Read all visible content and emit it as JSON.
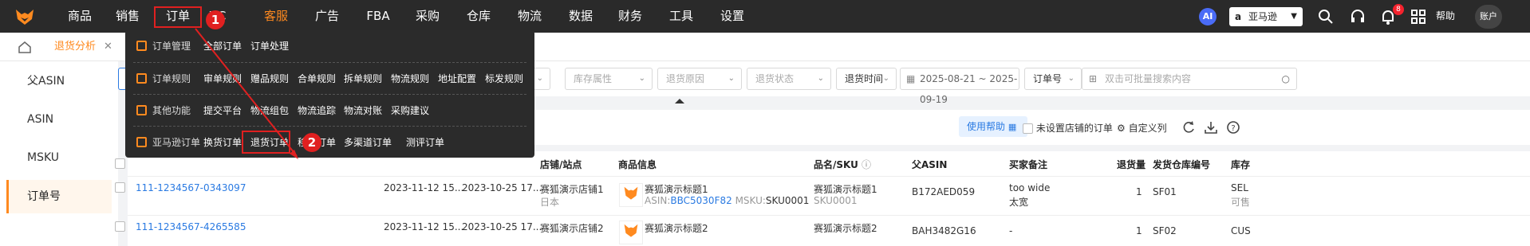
{
  "nav": {
    "items": [
      "商品",
      "销售",
      "订单",
      "VC",
      "客服",
      "广告",
      "FBA",
      "采购",
      "仓库",
      "物流",
      "数据",
      "财务",
      "工具",
      "设置"
    ],
    "ai_label": "AI",
    "marketplace": "亚马逊",
    "notification_count": "8",
    "help": "帮助",
    "account": "账户"
  },
  "tabs": {
    "active": "退货分析"
  },
  "sidebar": {
    "items": [
      "父ASIN",
      "ASIN",
      "MSKU",
      "订单号"
    ],
    "active_index": 3
  },
  "filters": {
    "inventory_attr": "库存属性",
    "return_reason": "退货原因",
    "return_status": "退货状态",
    "time_type": "退货时间",
    "date_range": "2025-08-21 ~ 2025-09-19",
    "search_field": "订单号",
    "search_placeholder": "双击可批量搜索内容"
  },
  "toolbar": {
    "help_btn": "使用帮助",
    "unset_store": "未设置店铺的订单",
    "custom_cols": "自定义列"
  },
  "table": {
    "headers": [
      "店铺/站点",
      "商品信息",
      "品名/SKU",
      "父ASIN",
      "买家备注",
      "退货量",
      "发货仓库编号",
      "库存"
    ],
    "rows": [
      {
        "order": "111-1234567-0343097",
        "date1": "2023-11-12 15...",
        "date2": "2023-10-25 17...",
        "store": "赛狐演示店铺1",
        "site": "日本",
        "product_title": "赛狐演示标题1",
        "asin_label": "ASIN:",
        "asin": "BBC5030F82",
        "msku_label": "MSKU:",
        "msku": "SKU0001",
        "name": "赛狐演示标题1",
        "sku": "SKU0001",
        "parent_asin": "B172AED059",
        "note1": "too wide",
        "note2": "太宽",
        "qty": "1",
        "warehouse": "SF01",
        "stock1": "SEL",
        "stock2": "可售"
      },
      {
        "order": "111-1234567-4265585",
        "date1": "2023-11-12 15...",
        "date2": "2023-10-25 17...",
        "store": "赛狐演示店铺2",
        "product_title": "赛狐演示标题2",
        "name": "赛狐演示标题2",
        "parent_asin": "BAH3482G16",
        "note1": "-",
        "qty": "1",
        "warehouse": "SF02",
        "stock1": "CUS"
      }
    ]
  },
  "menu": {
    "rows": [
      {
        "category": "订单管理",
        "links": [
          "全部订单",
          "订单处理"
        ]
      },
      {
        "category": "订单规则",
        "links": [
          "审单规则",
          "赠品规则",
          "合单规则",
          "拆单规则",
          "物流规则",
          "地址配置",
          "标发规则"
        ]
      },
      {
        "category": "其他功能",
        "links": [
          "提交平台",
          "物流组包",
          "物流追踪",
          "物流对账",
          "采购建议"
        ]
      },
      {
        "category": "亚马逊订单",
        "links": [
          "换货订单",
          "退货订单",
          "移除订单",
          "多渠道订单",
          "测评订单"
        ]
      }
    ]
  },
  "callouts": [
    "1",
    "2"
  ],
  "colors": {
    "accent": "#ff8a1f",
    "nav_bg": "#2a2a2a",
    "highlight": "#e02020",
    "link": "#2a7ae2"
  }
}
